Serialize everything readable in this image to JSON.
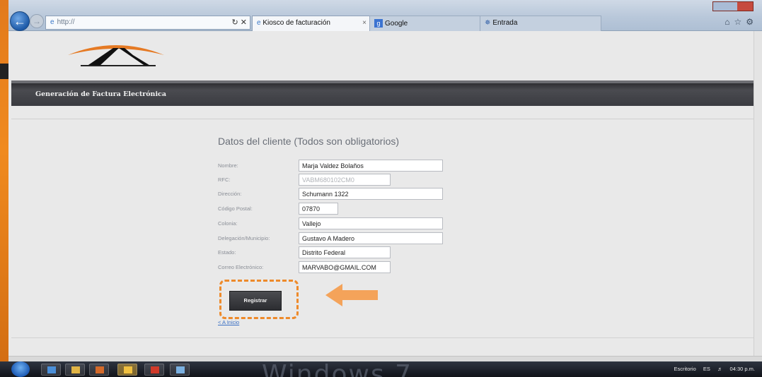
{
  "browser": {
    "address": "http://",
    "tabs": [
      {
        "label": "Kiosco de facturación",
        "active": true
      },
      {
        "label": "Google",
        "active": false
      },
      {
        "label": "Entrada",
        "active": false
      }
    ]
  },
  "header": {
    "title": "Generación de Factura Electrónica"
  },
  "form": {
    "title": "Datos del cliente (Todos son obligatorios)",
    "fields": [
      {
        "label": "Nombre:",
        "value": "Marja Valdez Bolaños"
      },
      {
        "label": "RFC:",
        "value": "VABM680102CM0"
      },
      {
        "label": "Dirección:",
        "value": "Schumann 1322"
      },
      {
        "label": "Código Postal:",
        "value": "07870"
      },
      {
        "label": "Colonia:",
        "value": "Vallejo"
      },
      {
        "label": "Delegación/Municipio:",
        "value": "Gustavo A Madero"
      },
      {
        "label": "Estado:",
        "value": "Distrito Federal"
      },
      {
        "label": "Correo Electrónico:",
        "value": "MARVABO@GMAIL.COM"
      }
    ],
    "submit_label": "Registrar",
    "back_link": "< A Inicio"
  },
  "taskbar": {
    "watermark": "Windows 7",
    "desktop_label": "Escritorio",
    "language": "ES",
    "clock": "04:30 p.m."
  },
  "colors": {
    "accent_orange": "#ee8a2a",
    "header_dark": "#3a3b40",
    "link_blue": "#3a6fc4"
  }
}
